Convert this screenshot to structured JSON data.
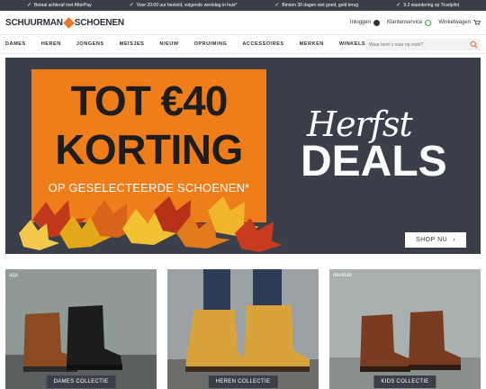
{
  "usp_bar": [
    "Betaal achteraf met AfterPay",
    "Voor 20:00 uur besteld, volgende werkdag in huis*",
    "Binnen 30 dagen niet goed, geld terug",
    "9.2 waardering op Trustpilot"
  ],
  "header": {
    "logo_left": "SCHUURMAN",
    "logo_right": "SCHOENEN",
    "login": "Inloggen",
    "service": "Klantenservice",
    "cart": "Winkelwagen"
  },
  "nav": {
    "items": [
      "DAMES",
      "HEREN",
      "JONGENS",
      "MEISJES",
      "NIEUW",
      "OPRUIMING",
      "ACCESSOIRES",
      "MERKEN",
      "WINKELS"
    ],
    "search_placeholder": "Waar bent u naar op zoek?"
  },
  "hero": {
    "line1": "TOT €40",
    "line2": "KORTING",
    "line3": "OP GESELECTEERDE SCHOENEN*",
    "herfst": "Herfst",
    "deals": "DEALS",
    "cta": "SHOP NU",
    "cta_arrow": "›",
    "colors": {
      "background": "#3a3f4a",
      "promo": "#ef7d1a"
    }
  },
  "collections": [
    {
      "label": "DAMES COLLECTIE",
      "brand": "aqa"
    },
    {
      "label": "HEREN COLLECTIE",
      "brand": ""
    },
    {
      "label": "KIDS COLLECTIE",
      "brand": "develab"
    }
  ]
}
